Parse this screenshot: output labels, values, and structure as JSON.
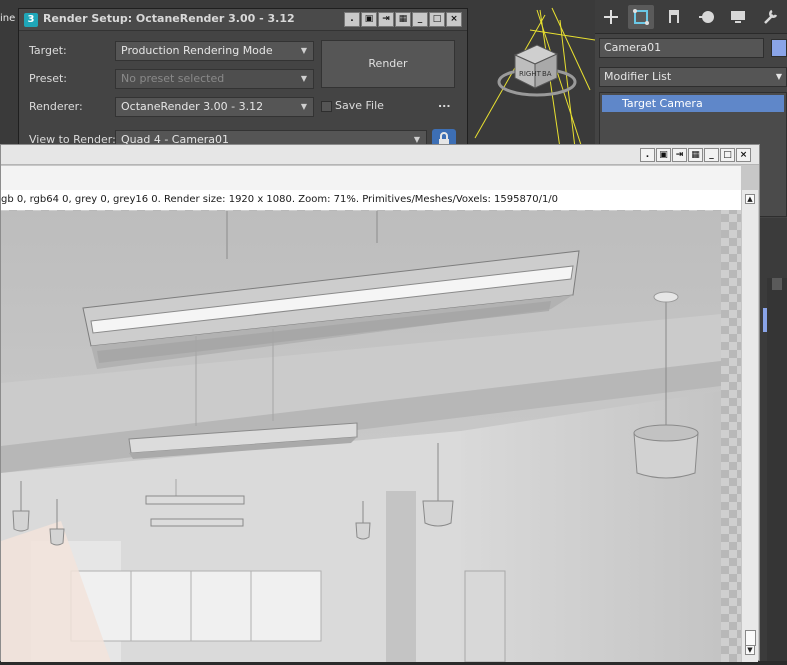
{
  "viewport": {
    "label_fragment": "ine",
    "viewcube_label_left": "RIGHT",
    "viewcube_label_right": "BA"
  },
  "command_panel": {
    "tabs": [
      {
        "icon": "plus-icon",
        "label": "Create"
      },
      {
        "icon": "modify-icon",
        "label": "Modify"
      },
      {
        "icon": "hierarchy-icon",
        "label": "Hierarchy"
      },
      {
        "icon": "motion-icon",
        "label": "Motion"
      },
      {
        "icon": "display-icon",
        "label": "Display"
      },
      {
        "icon": "utilities-icon",
        "label": "Utilities"
      }
    ],
    "object_name": "Camera01",
    "object_color": "#8aa4e8",
    "modifier_list": "Modifier List",
    "stack_item": "Target Camera"
  },
  "render_setup": {
    "title": "Render Setup: OctaneRender 3.00 - 3.12",
    "target_label": "Target:",
    "target_value": "Production Rendering Mode",
    "preset_label": "Preset:",
    "preset_value": "No preset selected",
    "renderer_label": "Renderer:",
    "renderer_value": "OctaneRender 3.00 - 3.12",
    "view_label": "View to Render:",
    "view_value": "Quad 4 - Camera01",
    "render_button": "Render",
    "save_file_label": "Save File",
    "more_button": "...",
    "window_buttons": [
      ".",
      "▣",
      "⇥",
      "▦",
      "_",
      "□",
      "×"
    ]
  },
  "frame_buffer": {
    "window_buttons": [
      ".",
      "▣",
      "⇥",
      "▦",
      "_",
      "□",
      "×"
    ],
    "status_text": "gb 0, rgb64 0, grey 0, grey16 0.   Render size: 1920 x 1080.   Zoom: 71%.   Primitives/Meshes/Voxels: 1595870/1/0"
  },
  "colors": {
    "accent_blue": "#5f87c9",
    "octane_logo": "#1fa6b8",
    "lock_blue": "#3d6fb5"
  }
}
